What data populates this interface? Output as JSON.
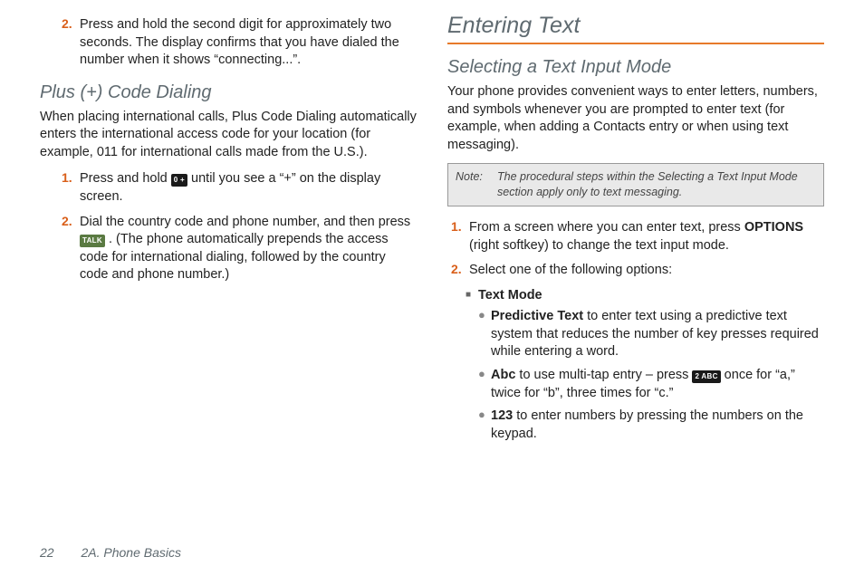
{
  "left": {
    "step2": {
      "num": "2.",
      "text": "Press and hold the second digit for approximately two seconds. The display confirms that you have dialed the number when it shows “connecting...”."
    },
    "heading": "Plus (+) Code Dialing",
    "intro": "When placing international calls, Plus Code Dialing automatically enters the international access code for your location (for example, 011 for international calls made from the U.S.).",
    "pstep1": {
      "num": "1.",
      "pre": "Press and hold ",
      "key": "0 +",
      "post": " until you see a “+” on the display screen."
    },
    "pstep2": {
      "num": "2.",
      "pre": "Dial the country code and phone number, and then press ",
      "key": "TALK",
      "post": ". (The phone automatically prepends the access code for international dialing, followed by the country code and phone number.)"
    }
  },
  "right": {
    "h1": "Entering Text",
    "h2": "Selecting a Text Input Mode",
    "intro": "Your phone provides convenient ways to enter letters, numbers, and symbols whenever you are prompted to enter text (for example, when adding a Contacts entry or when using text messaging).",
    "note": {
      "label": "Note:",
      "text": "The procedural steps within the Selecting a Text Input Mode section apply only to text messaging."
    },
    "step1": {
      "num": "1.",
      "pre": "From a screen where you can enter text, press ",
      "bold": "OPTIONS",
      "post": " (right softkey) to change the text input mode."
    },
    "step2": {
      "num": "2.",
      "text": "Select one of the following options:"
    },
    "textmode_label": "Text Mode",
    "opt_predictive": {
      "label": "Predictive Text",
      "rest": " to enter text using a predictive text system that reduces the number of key presses required while entering a word."
    },
    "opt_abc": {
      "label": "Abc",
      "pre": " to use multi-tap entry – press ",
      "key": "2 ABC",
      "post": " once for “a,” twice for “b”, three times for “c.”"
    },
    "opt_123": {
      "label": "123",
      "rest": " to enter numbers by pressing the numbers on the keypad."
    }
  },
  "footer": {
    "page": "22",
    "section": "2A. Phone Basics"
  }
}
